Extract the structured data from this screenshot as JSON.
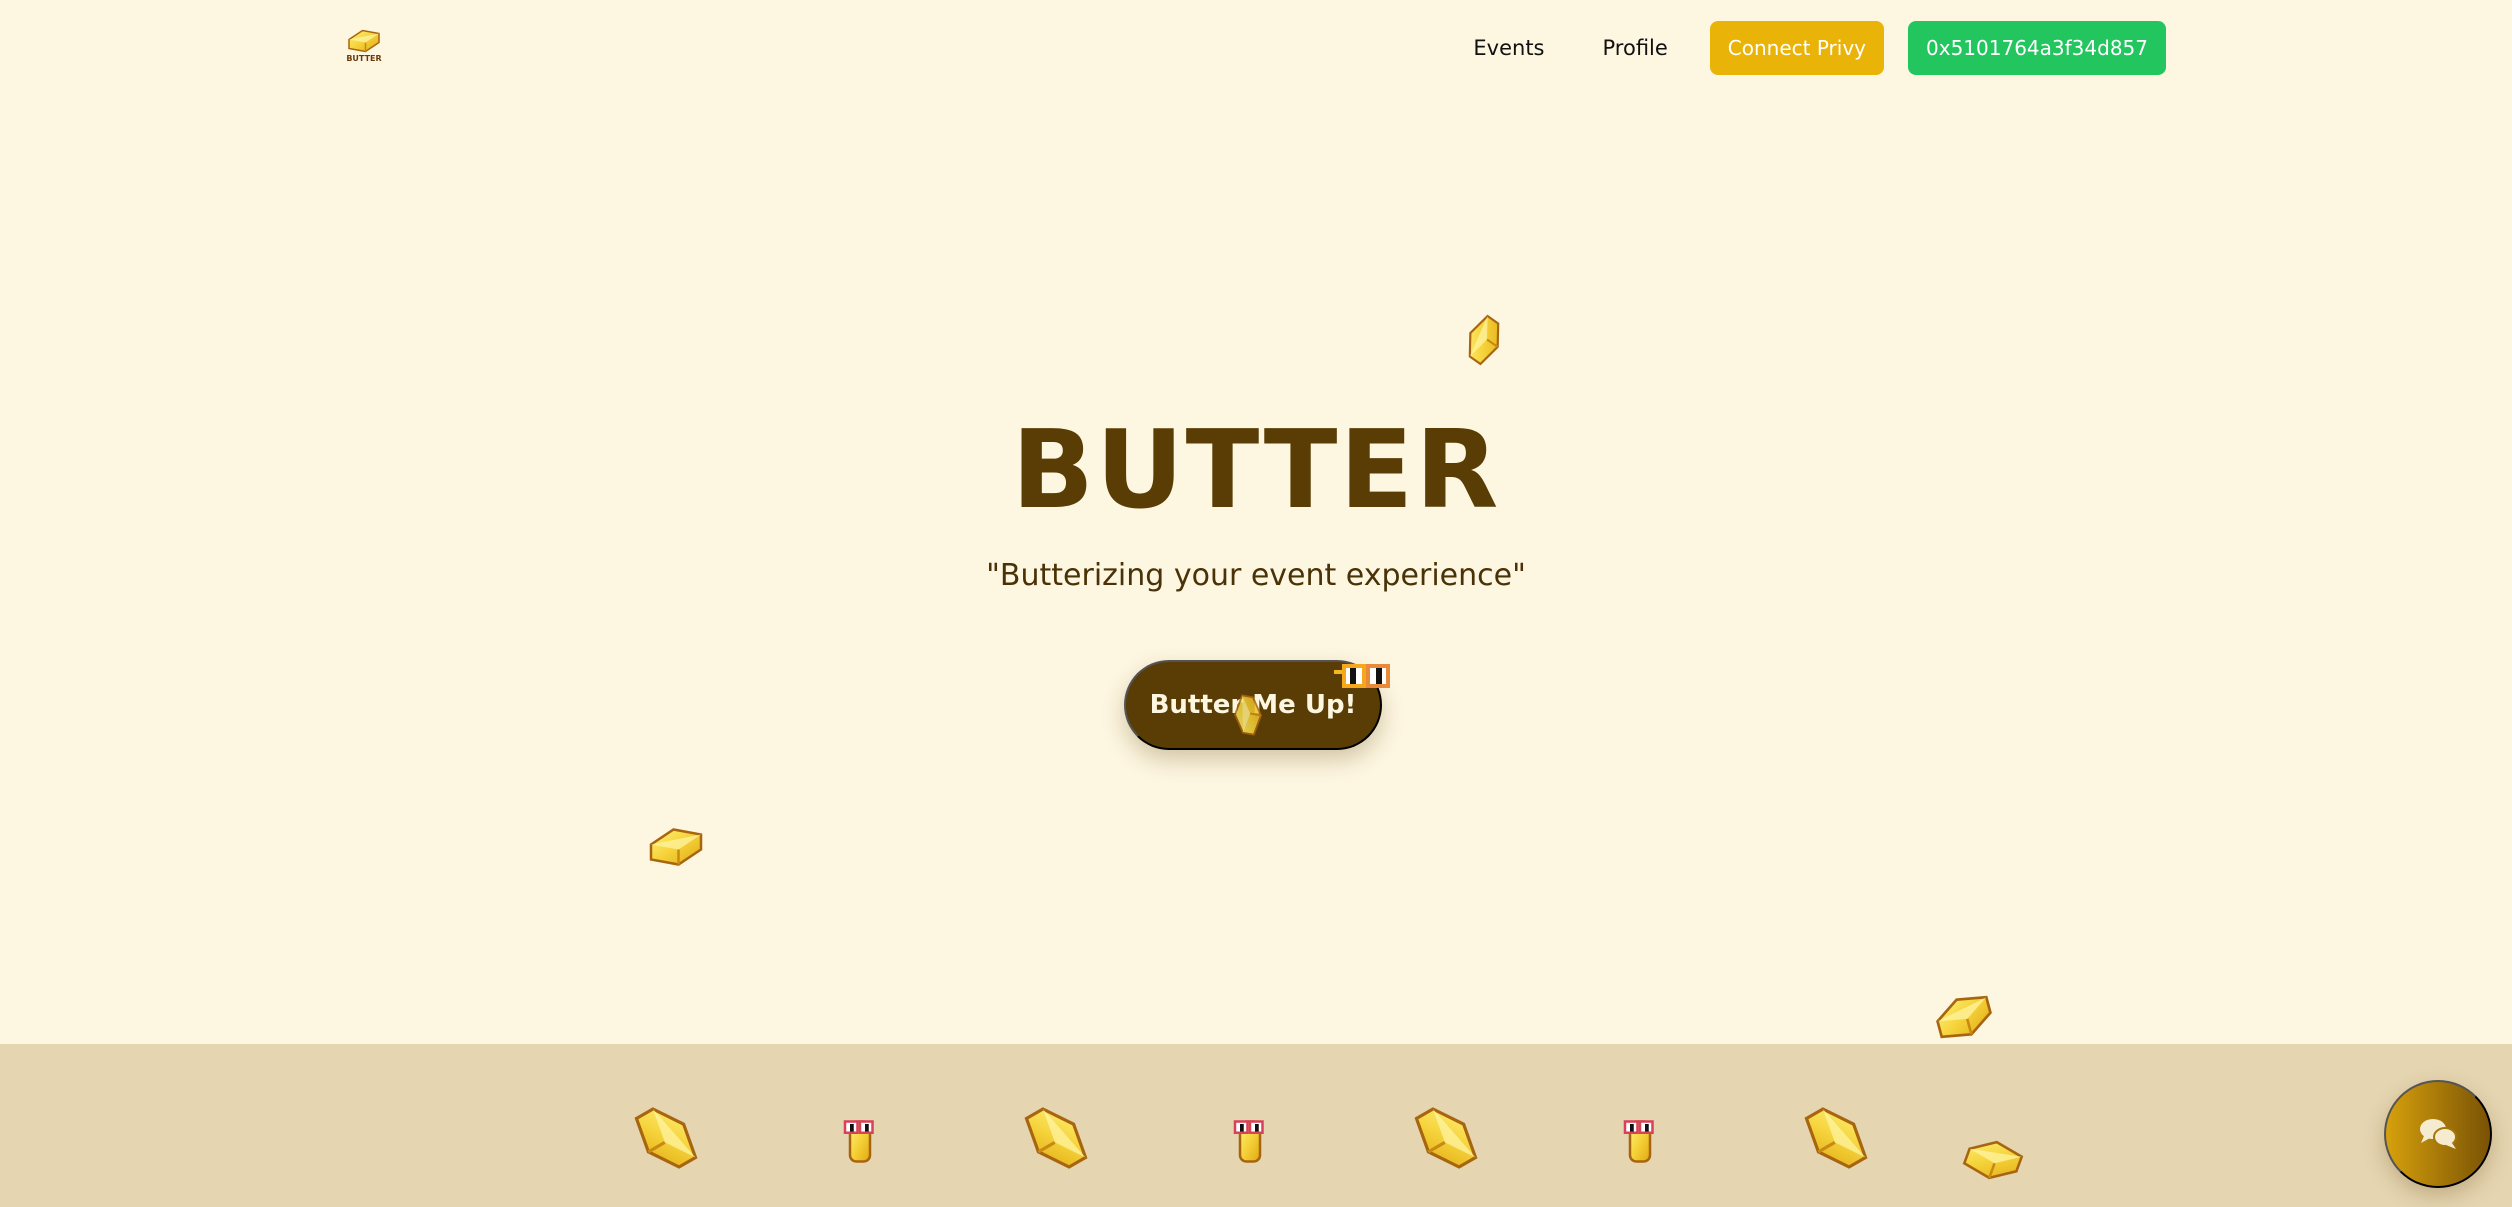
{
  "nav": {
    "logo_text": "BUTTER",
    "logo_icon": "butter-bar-icon",
    "links": [
      {
        "label": "Events"
      },
      {
        "label": "Profile"
      }
    ],
    "connect_button": "Connect Privy",
    "wallet_address": "0x5101764a3f34d857",
    "colors": {
      "connect": "#eab308",
      "wallet": "#22c55e"
    }
  },
  "hero": {
    "title": "BUTTER",
    "tagline": "\"Butterizing your event experience\"",
    "cta_label": "Butter Me Up!"
  },
  "decorations": {
    "floating_icon": "butter-bar-icon",
    "strip_icons": [
      "butter-bar-icon",
      "butter-sunglasses-icon",
      "butter-bar-icon",
      "butter-sunglasses-icon",
      "butter-bar-icon",
      "butter-sunglasses-icon",
      "butter-bar-icon"
    ]
  },
  "chat": {
    "icon": "chat-bubbles-icon"
  },
  "colors": {
    "background": "#fdf6e0",
    "strip": "#e5d5b0",
    "brown": "#5a3d05",
    "butter": "#f5d23a"
  }
}
